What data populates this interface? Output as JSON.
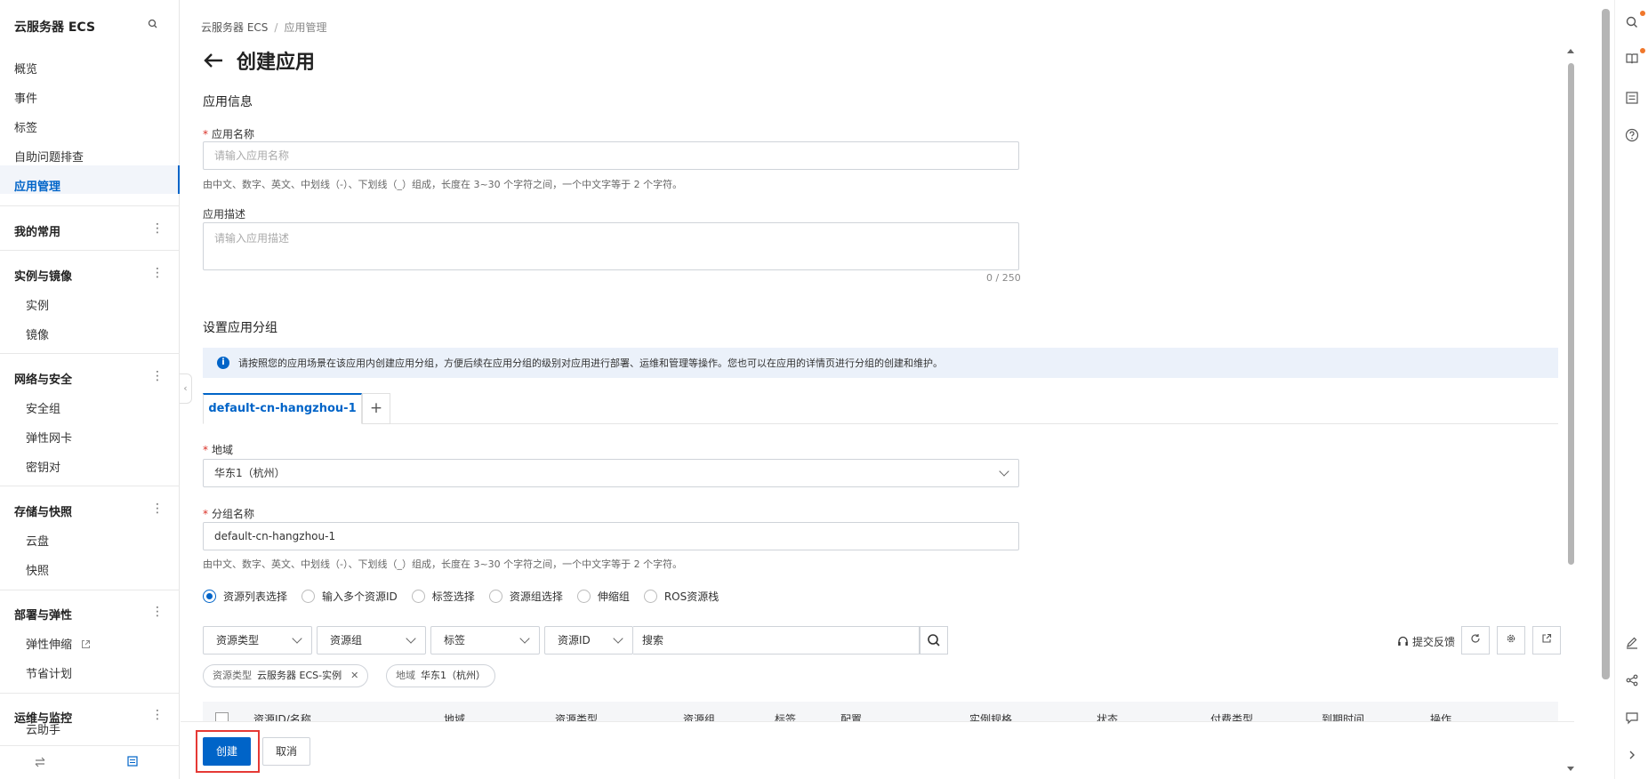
{
  "sidebar": {
    "title": "云服务器 ECS",
    "items": [
      {
        "label": "概览"
      },
      {
        "label": "事件"
      },
      {
        "label": "标签"
      },
      {
        "label": "自助问题排查"
      },
      {
        "label": "应用管理"
      }
    ],
    "groups": [
      {
        "label": "我的常用",
        "children": []
      },
      {
        "label": "实例与镜像",
        "children": [
          "实例",
          "镜像"
        ]
      },
      {
        "label": "网络与安全",
        "children": [
          "安全组",
          "弹性网卡",
          "密钥对"
        ]
      },
      {
        "label": "存储与快照",
        "children": [
          "云盘",
          "快照"
        ]
      },
      {
        "label": "部署与弹性",
        "children": [
          "弹性伸缩",
          "节省计划"
        ]
      },
      {
        "label": "运维与监控",
        "children": [
          "云助手"
        ]
      }
    ],
    "more_icon": "⋮"
  },
  "breadcrumb": [
    "云服务器 ECS",
    "应用管理"
  ],
  "page_title": "创建应用",
  "app_info": {
    "section_title": "应用信息",
    "name_label": "应用名称",
    "name_placeholder": "请输入应用名称",
    "name_hint": "由中文、数字、英文、中划线（-）、下划线（_）组成，长度在 3~30 个字符之间，一个中文字等于 2 个字符。",
    "desc_label": "应用描述",
    "desc_placeholder": "请输入应用描述",
    "desc_counter": "0 / 250"
  },
  "group_section": {
    "title": "设置应用分组",
    "info_text": "请按照您的应用场景在该应用内创建应用分组，方便后续在应用分组的级别对应用进行部署、运维和管理等操作。您也可以在应用的详情页进行分组的创建和维护。",
    "tab_label": "default-cn-hangzhou-1",
    "region_label": "地域",
    "region_value": "华东1（杭州）",
    "group_name_label": "分组名称",
    "group_name_value": "default-cn-hangzhou-1",
    "group_name_hint": "由中文、数字、英文、中划线（-）、下划线（_）组成，长度在 3~30 个字符之间，一个中文字等于 2 个字符。",
    "radios": [
      {
        "label": "资源列表选择",
        "selected": true
      },
      {
        "label": "输入多个资源ID",
        "selected": false
      },
      {
        "label": "标签选择",
        "selected": false
      },
      {
        "label": "资源组选择",
        "selected": false
      },
      {
        "label": "伸缩组",
        "selected": false
      },
      {
        "label": "ROS资源栈",
        "selected": false
      }
    ],
    "filters": [
      "资源类型",
      "资源组",
      "标签",
      "资源ID"
    ],
    "search_label": "搜索",
    "feedback_label": "提交反馈",
    "tags": [
      {
        "key": "资源类型",
        "value": "云服务器 ECS-实例"
      },
      {
        "key": "地域",
        "value": "华东1（杭州）"
      }
    ],
    "table_columns": [
      "资源ID/名称",
      "地域",
      "资源类型",
      "资源组",
      "标签",
      "配置",
      "实例规格",
      "状态",
      "付费类型",
      "到期时间",
      "操作"
    ]
  },
  "footer": {
    "create_label": "创建",
    "cancel_label": "取消"
  },
  "colors": {
    "primary": "#0064c8",
    "highlight": "#e53935",
    "required": "#d93026"
  }
}
